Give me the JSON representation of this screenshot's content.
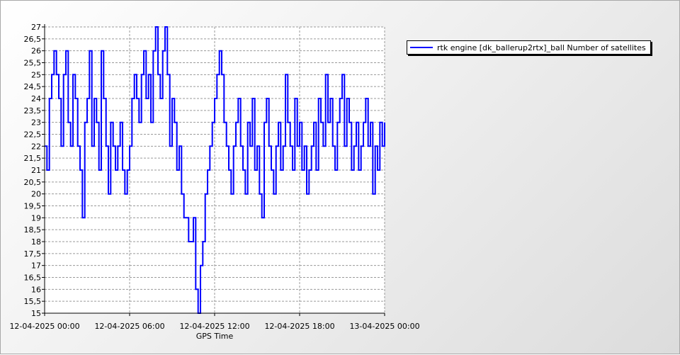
{
  "chart_data": {
    "type": "line",
    "xlabel": "GPS Time",
    "ylabel": "",
    "x_tick_labels": [
      "12-04-2025 00:00",
      "12-04-2025 06:00",
      "12-04-2025 12:00",
      "12-04-2025 18:00",
      "13-04-2025 00:00"
    ],
    "y_tick_labels": [
      "15",
      "15,5",
      "16",
      "16,5",
      "17",
      "17,5",
      "18",
      "18,5",
      "19",
      "19,5",
      "20",
      "20,5",
      "21",
      "21,5",
      "22",
      "22,5",
      "23",
      "23,5",
      "24",
      "24,5",
      "25",
      "25,5",
      "26",
      "26,5",
      "27"
    ],
    "xlim": [
      "12-04-2025 00:00",
      "13-04-2025 00:00"
    ],
    "ylim": [
      15,
      27
    ],
    "grid": true,
    "legend_position": "top-right, outside plot area",
    "series": [
      {
        "name": "rtk engine [dk_ballerup2rtx]_ball Number of satellites",
        "color": "#0000ff",
        "x": [
          "00:00",
          "00:10",
          "00:20",
          "00:30",
          "00:40",
          "00:50",
          "01:00",
          "01:10",
          "01:20",
          "01:30",
          "01:40",
          "01:50",
          "02:00",
          "02:10",
          "02:20",
          "02:30",
          "02:40",
          "02:50",
          "03:00",
          "03:10",
          "03:20",
          "03:30",
          "03:40",
          "03:50",
          "04:00",
          "04:10",
          "04:20",
          "04:30",
          "04:40",
          "04:50",
          "05:00",
          "05:10",
          "05:20",
          "05:30",
          "05:40",
          "05:50",
          "06:00",
          "06:10",
          "06:20",
          "06:30",
          "06:40",
          "06:50",
          "07:00",
          "07:10",
          "07:20",
          "07:30",
          "07:40",
          "07:50",
          "08:00",
          "08:10",
          "08:20",
          "08:30",
          "08:40",
          "08:50",
          "09:00",
          "09:10",
          "09:20",
          "09:30",
          "09:40",
          "09:50",
          "10:00",
          "10:10",
          "10:20",
          "10:30",
          "10:40",
          "10:50",
          "11:00",
          "11:10",
          "11:20",
          "11:30",
          "11:40",
          "11:50",
          "12:00",
          "12:10",
          "12:20",
          "12:30",
          "12:40",
          "12:50",
          "13:00",
          "13:10",
          "13:20",
          "13:30",
          "13:40",
          "13:50",
          "14:00",
          "14:10",
          "14:20",
          "14:30",
          "14:40",
          "14:50",
          "15:00",
          "15:10",
          "15:20",
          "15:30",
          "15:40",
          "15:50",
          "16:00",
          "16:10",
          "16:20",
          "16:30",
          "16:40",
          "16:50",
          "17:00",
          "17:10",
          "17:20",
          "17:30",
          "17:40",
          "17:50",
          "18:00",
          "18:10",
          "18:20",
          "18:30",
          "18:40",
          "18:50",
          "19:00",
          "19:10",
          "19:20",
          "19:30",
          "19:40",
          "19:50",
          "20:00",
          "20:10",
          "20:20",
          "20:30",
          "20:40",
          "20:50",
          "21:00",
          "21:10",
          "21:20",
          "21:30",
          "21:40",
          "21:50",
          "22:00",
          "22:10",
          "22:20",
          "22:30",
          "22:40",
          "22:50",
          "23:00",
          "23:10",
          "23:20",
          "23:30",
          "23:40",
          "23:50",
          "24:00"
        ],
        "values": [
          22,
          21,
          24,
          25,
          26,
          25,
          24,
          22,
          25,
          26,
          23,
          22,
          25,
          24,
          22,
          21,
          19,
          23,
          24,
          26,
          22,
          24,
          23,
          21,
          26,
          24,
          22,
          20,
          23,
          22,
          21,
          22,
          23,
          21,
          20,
          21,
          22,
          24,
          25,
          24,
          23,
          25,
          26,
          24,
          25,
          23,
          26,
          27,
          25,
          24,
          26,
          27,
          25,
          22,
          24,
          23,
          21,
          22,
          20,
          19,
          19,
          18,
          18,
          19,
          16,
          15,
          17,
          18,
          20,
          21,
          22,
          23,
          24,
          25,
          26,
          25,
          23,
          22,
          21,
          20,
          22,
          23,
          24,
          22,
          21,
          20,
          23,
          22,
          24,
          21,
          22,
          20,
          19,
          23,
          24,
          22,
          21,
          20,
          22,
          23,
          21,
          22,
          25,
          23,
          22,
          21,
          24,
          22,
          23,
          21,
          22,
          20,
          21,
          22,
          23,
          21,
          24,
          23,
          22,
          25,
          23,
          24,
          22,
          21,
          23,
          24,
          25,
          22,
          24,
          23,
          21,
          22,
          23,
          21,
          22,
          23,
          24,
          22,
          23,
          20,
          22,
          21,
          23,
          22,
          23
        ]
      }
    ]
  }
}
